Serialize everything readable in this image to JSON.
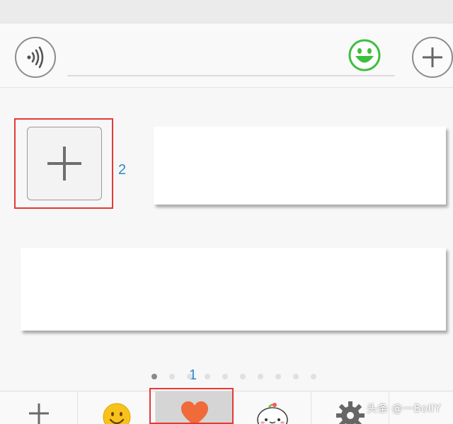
{
  "input_bar": {
    "voice_icon": "voice-wave-icon",
    "text_value": "",
    "emoji_icon": "green-smile-emoji-icon",
    "plus_icon": "plus-circle-icon",
    "accent_green": "#3fbf3f"
  },
  "content": {
    "add_tile_icon": "plus-icon",
    "annotation_2": "2",
    "annotation_1": "1",
    "highlight_color": "#e53935",
    "annotation_color": "#2f88ce"
  },
  "pager": {
    "total": 10,
    "active": 0
  },
  "bottom_nav": {
    "items": [
      {
        "icon": "plus-icon"
      },
      {
        "icon": "yellow-smiley-icon"
      },
      {
        "icon": "heart-icon",
        "selected": true
      },
      {
        "icon": "sticker-face-icon"
      },
      {
        "icon": "gear-icon"
      }
    ]
  },
  "watermark": "头条 @一BoIIY"
}
